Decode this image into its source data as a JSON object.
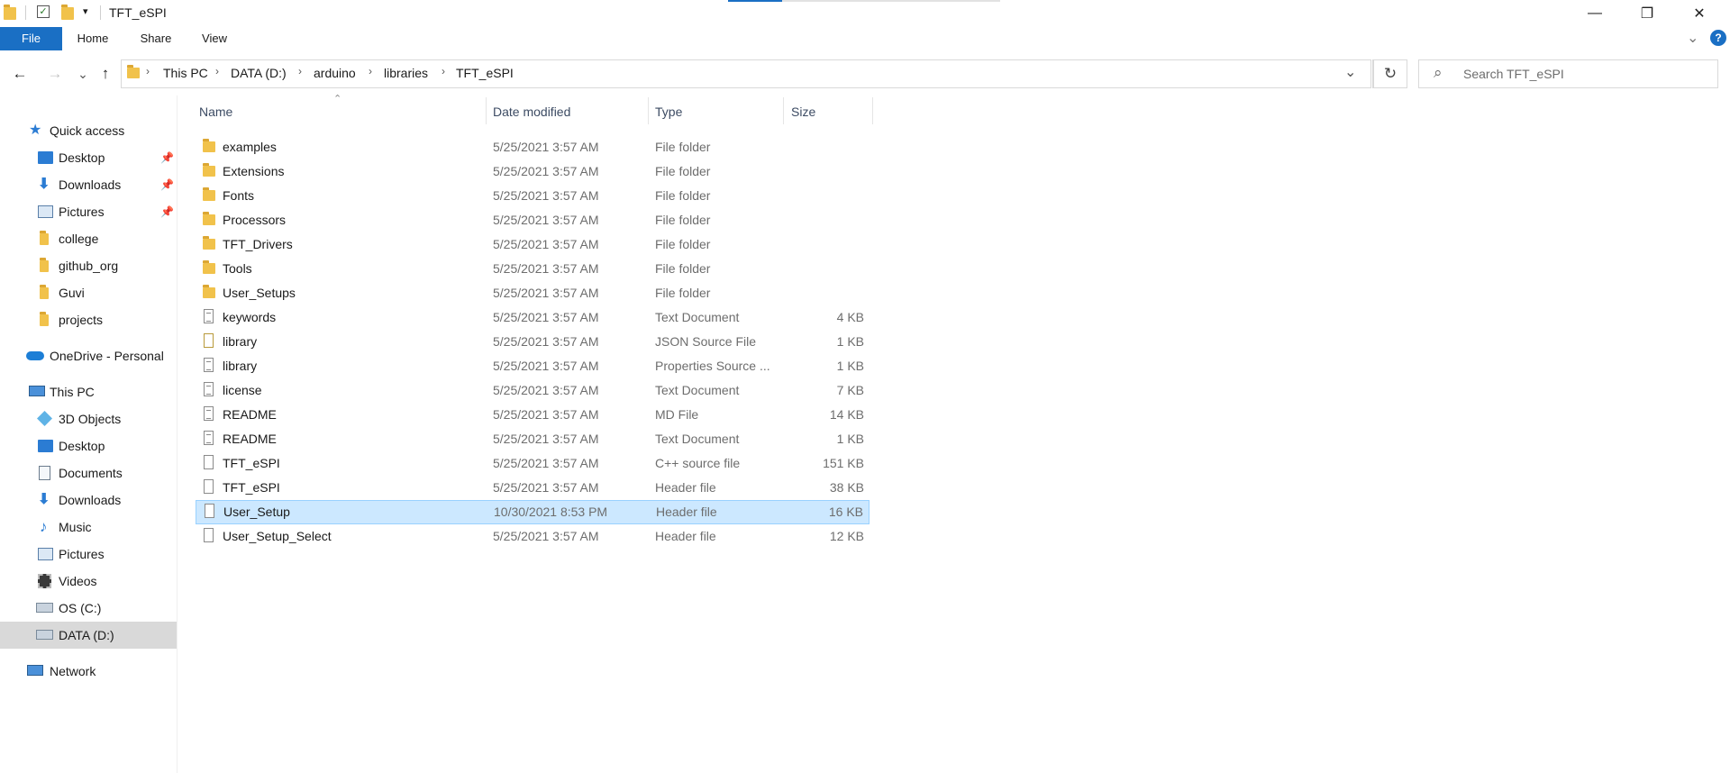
{
  "window": {
    "title": "TFT_eSPI",
    "minimize_glyph": "—",
    "maximize_glyph": "❐",
    "close_glyph": "✕"
  },
  "ribbon": {
    "tabs": [
      "File",
      "Home",
      "Share",
      "View"
    ],
    "help_glyph": "?",
    "expand_glyph": "⌄"
  },
  "navigation": {
    "back_glyph": "←",
    "forward_glyph": "→",
    "recent_glyph": "⌄",
    "up_glyph": "↑",
    "refresh_glyph": "↻",
    "dropdown_glyph": "⌄"
  },
  "breadcrumb": [
    "This PC",
    "DATA (D:)",
    "arduino",
    "libraries",
    "TFT_eSPI"
  ],
  "breadcrumb_sep": "›",
  "search": {
    "placeholder": "Search TFT_eSPI",
    "icon": "search-icon",
    "glyph": "⌕"
  },
  "sidebar": {
    "quick_access": "Quick access",
    "quick_items": [
      {
        "label": "Desktop",
        "icon": "desktop-icon",
        "pinned": true
      },
      {
        "label": "Downloads",
        "icon": "downloads-icon",
        "pinned": true
      },
      {
        "label": "Pictures",
        "icon": "pictures-icon",
        "pinned": true
      },
      {
        "label": "college",
        "icon": "folder-icon",
        "pinned": false
      },
      {
        "label": "github_org",
        "icon": "folder-icon",
        "pinned": false
      },
      {
        "label": "Guvi",
        "icon": "folder-icon",
        "pinned": false
      },
      {
        "label": "projects",
        "icon": "folder-icon",
        "pinned": false
      }
    ],
    "onedrive": "OneDrive - Personal",
    "this_pc": "This PC",
    "pc_items": [
      {
        "label": "3D Objects",
        "icon": "3d-objects-icon"
      },
      {
        "label": "Desktop",
        "icon": "desktop-icon"
      },
      {
        "label": "Documents",
        "icon": "documents-icon"
      },
      {
        "label": "Downloads",
        "icon": "downloads-icon"
      },
      {
        "label": "Music",
        "icon": "music-icon"
      },
      {
        "label": "Pictures",
        "icon": "pictures-icon"
      },
      {
        "label": "Videos",
        "icon": "videos-icon"
      },
      {
        "label": "OS (C:)",
        "icon": "drive-c-icon"
      },
      {
        "label": "DATA (D:)",
        "icon": "drive-d-icon"
      }
    ],
    "network": "Network",
    "pin_glyph": "📌"
  },
  "columns": {
    "name": "Name",
    "date": "Date modified",
    "type": "Type",
    "size": "Size"
  },
  "files": [
    {
      "name": "examples",
      "date": "5/25/2021 3:57 AM",
      "type": "File folder",
      "size": "",
      "kind": "folder"
    },
    {
      "name": "Extensions",
      "date": "5/25/2021 3:57 AM",
      "type": "File folder",
      "size": "",
      "kind": "folder"
    },
    {
      "name": "Fonts",
      "date": "5/25/2021 3:57 AM",
      "type": "File folder",
      "size": "",
      "kind": "folder"
    },
    {
      "name": "Processors",
      "date": "5/25/2021 3:57 AM",
      "type": "File folder",
      "size": "",
      "kind": "folder"
    },
    {
      "name": "TFT_Drivers",
      "date": "5/25/2021 3:57 AM",
      "type": "File folder",
      "size": "",
      "kind": "folder"
    },
    {
      "name": "Tools",
      "date": "5/25/2021 3:57 AM",
      "type": "File folder",
      "size": "",
      "kind": "folder"
    },
    {
      "name": "User_Setups",
      "date": "5/25/2021 3:57 AM",
      "type": "File folder",
      "size": "",
      "kind": "folder"
    },
    {
      "name": "keywords",
      "date": "5/25/2021 3:57 AM",
      "type": "Text Document",
      "size": "4 KB",
      "kind": "text"
    },
    {
      "name": "library",
      "date": "5/25/2021 3:57 AM",
      "type": "JSON Source File",
      "size": "1 KB",
      "kind": "json"
    },
    {
      "name": "library",
      "date": "5/25/2021 3:57 AM",
      "type": "Properties Source ...",
      "size": "1 KB",
      "kind": "text"
    },
    {
      "name": "license",
      "date": "5/25/2021 3:57 AM",
      "type": "Text Document",
      "size": "7 KB",
      "kind": "text"
    },
    {
      "name": "README",
      "date": "5/25/2021 3:57 AM",
      "type": "MD File",
      "size": "14 KB",
      "kind": "text"
    },
    {
      "name": "README",
      "date": "5/25/2021 3:57 AM",
      "type": "Text Document",
      "size": "1 KB",
      "kind": "text"
    },
    {
      "name": "TFT_eSPI",
      "date": "5/25/2021 3:57 AM",
      "type": "C++ source file",
      "size": "151 KB",
      "kind": "blank"
    },
    {
      "name": "TFT_eSPI",
      "date": "5/25/2021 3:57 AM",
      "type": "Header file",
      "size": "38 KB",
      "kind": "blank"
    },
    {
      "name": "User_Setup",
      "date": "10/30/2021 8:53 PM",
      "type": "Header file",
      "size": "16 KB",
      "kind": "blank",
      "selected": true
    },
    {
      "name": "User_Setup_Select",
      "date": "5/25/2021 3:57 AM",
      "type": "Header file",
      "size": "12 KB",
      "kind": "blank"
    }
  ],
  "colors": {
    "accent": "#1a6fc4",
    "selection": "#cce8ff",
    "selection_border": "#99d1ff",
    "folder": "#f1c24b",
    "nav_selected": "#d9d9d9"
  }
}
